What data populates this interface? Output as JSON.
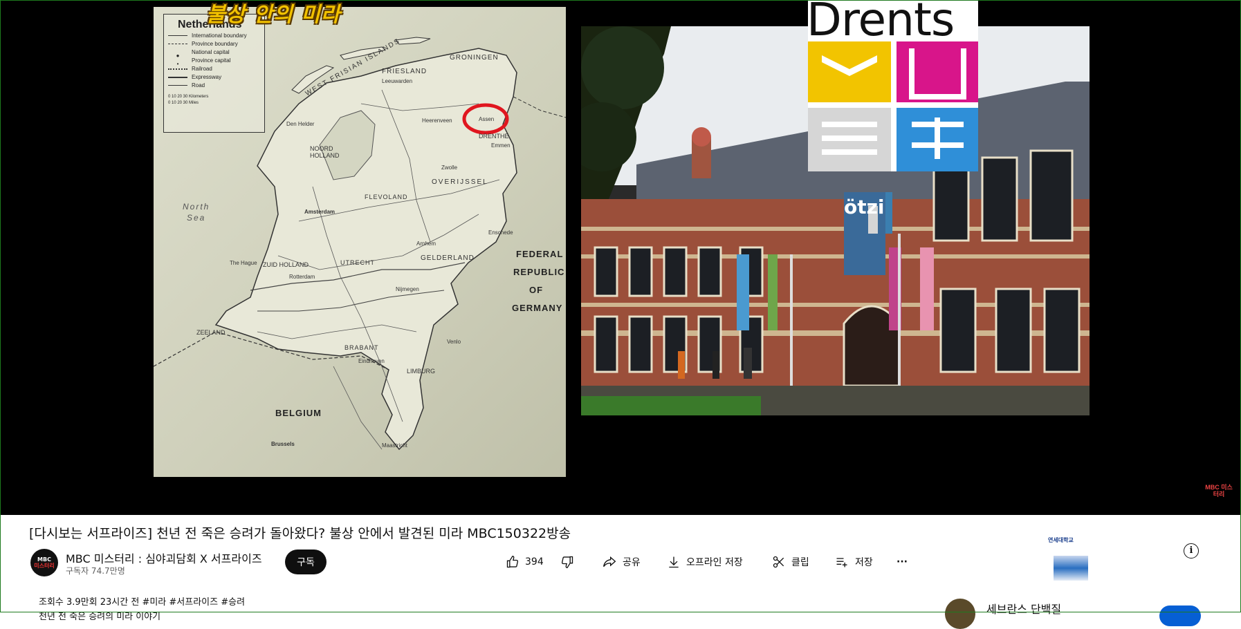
{
  "player": {
    "overlay_title": "불상 안의 미라",
    "channel_watermark": "MBC 미스터리",
    "map": {
      "legend_title": "Netherlands",
      "legend_items": [
        "International boundary",
        "Province boundary",
        "National capital",
        "Province capital",
        "Railroad",
        "Expressway",
        "Road"
      ],
      "scale_label": "0  10  20  30 Kilometers",
      "scale_label_miles": "0  10  20  30 Miles",
      "labels": {
        "frisian": "WEST FRISIAN ISLANDS",
        "groningen": "GRONINGEN",
        "friesland": "FRIESLAND",
        "drenthe": "DRENTHE",
        "assen": "Assen",
        "overijssel": "OVERIJSSEL",
        "flevoland": "FLEVOLAND",
        "noord_holland": "NOORD HOLLAND",
        "gelderland": "GELDERLAND",
        "zuid_holland": "ZUID HOLLAND",
        "utrecht": "UTRECHT",
        "zeeland": "ZEELAND",
        "brabant": "BRABANT",
        "limburg": "LIMBURG",
        "belgium": "BELGIUM",
        "germany1": "FEDERAL",
        "germany2": "REPUBLIC",
        "germany3": "OF",
        "germany4": "GERMANY",
        "north_sea1": "North",
        "north_sea2": "Sea",
        "amsterdam": "Amsterdam",
        "rotterdam": "Rotterdam",
        "the_hague": "The Hague",
        "leeuwarden": "Leeuwarden",
        "zwolle": "Zwolle",
        "arnhem": "Arnhem",
        "enschede": "Enschede",
        "eindhoven": "Eindhoven",
        "maastricht": "Maastricht",
        "den_helder": "Den Helder",
        "heerenveen": "Heerenveen",
        "emmen": "Emmen",
        "nijmegen": "Nijmegen",
        "brussels": "Brussels",
        "venlo": "Venlo"
      }
    },
    "museum": {
      "logo_word": "Drents",
      "banner_text": "ötzi"
    }
  },
  "video": {
    "title": "[다시보는 서프라이즈] 천년 전 죽은 승려가 돌아왔다? 불상 안에서 발견된 미라 MBC150322방송",
    "channel": {
      "avatar_text_top": "MBC",
      "avatar_text_bottom": "미스터리",
      "name": "MBC 미스터리 : 심야괴담회 X 서프라이즈",
      "subscribers": "구독자 74.7만명",
      "subscribe_label": "구독"
    },
    "actions": {
      "like_count": "394",
      "share": "공유",
      "download": "오프라인 저장",
      "clip": "클립",
      "save": "저장",
      "more": "···"
    },
    "description": {
      "views": "조회수 3.9만회",
      "time": "23시간 전",
      "tags": "#미라 #서프라이즈 #승려",
      "line2": "천년 전 죽은 승려의 미라 이야기"
    }
  },
  "ad": {
    "brand": "연세대학교"
  },
  "suggested": {
    "title": "세브란스 단백질"
  },
  "colors": {
    "player_bg": "#000000",
    "subscribe_bg": "#0f0f0f",
    "accent_blue": "#065fd4",
    "circle_red": "#e0161f"
  }
}
